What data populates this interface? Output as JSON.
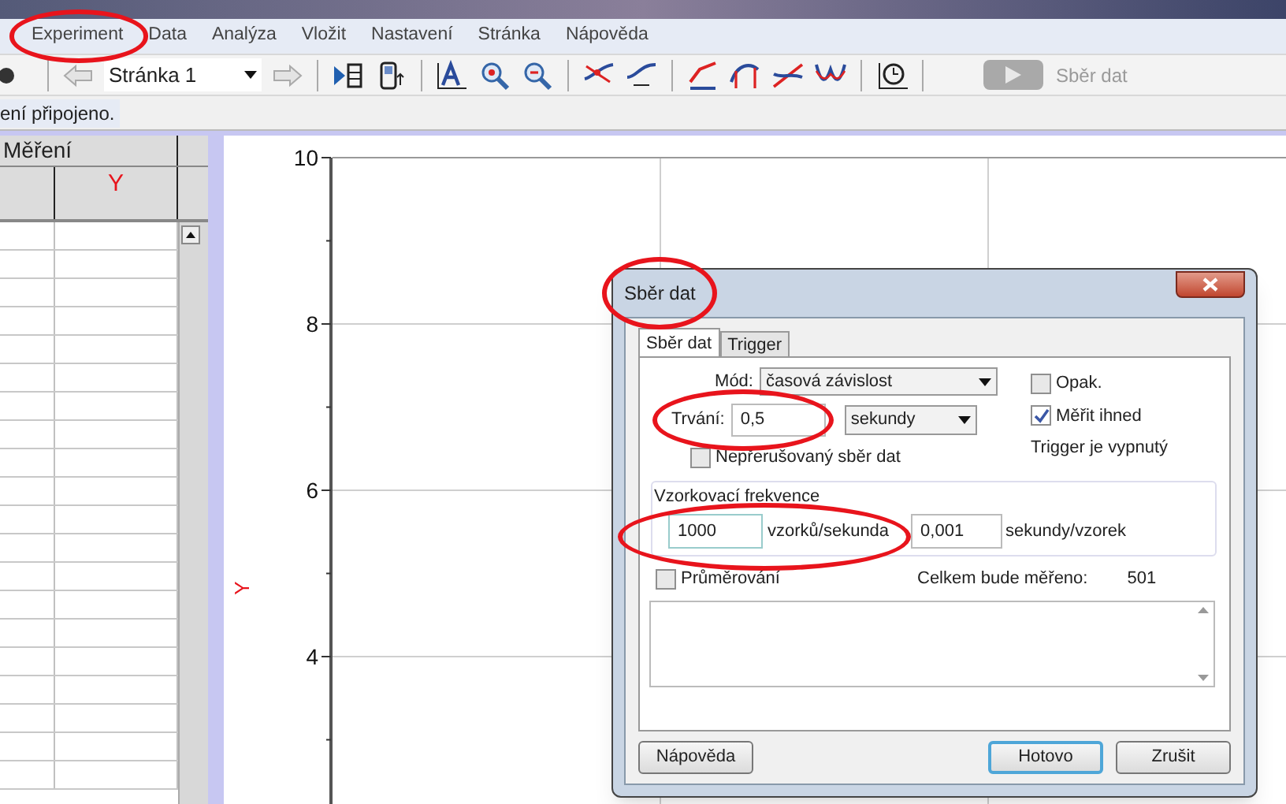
{
  "menu": [
    {
      "label": "Experiment",
      "circled": true
    },
    {
      "label": "Data",
      "circled": false
    },
    {
      "label": "Analýza",
      "circled": false
    },
    {
      "label": "Vložit",
      "circled": false
    },
    {
      "label": "Nastavení",
      "circled": false
    },
    {
      "label": "Stránka",
      "circled": false
    },
    {
      "label": "Nápověda",
      "circled": false
    }
  ],
  "toolbar": {
    "page_select": {
      "value": "Stránka 1"
    },
    "collect_button": {
      "label": "Sběr dat",
      "disabled": true
    }
  },
  "status": "ení připojeno.",
  "table": {
    "title": "Měření",
    "column_header": "Y"
  },
  "graph": {
    "y_axis_label": "Y",
    "y_ticks": [
      "10",
      "8",
      "6",
      "4"
    ]
  },
  "dialog": {
    "title": "Sběr dat",
    "circled": true,
    "tabs": [
      {
        "label": "Sběr dat",
        "selected": true
      },
      {
        "label": "Trigger",
        "selected": false
      }
    ],
    "mode": {
      "label": "Mód:",
      "value": "časová závislost"
    },
    "repeat": {
      "label": "Opak.",
      "checked": false
    },
    "measure_now": {
      "label": "Měřit ihned",
      "checked": true
    },
    "trigger_status": "Trigger je vypnutý",
    "duration": {
      "label": "Trvání:",
      "value": "0,5",
      "unit": "sekundy",
      "circled": true
    },
    "continuous": {
      "label": "Nepřerušovaný sběr dat",
      "checked": false
    },
    "sampling": {
      "title": "Vzorkovací frekvence",
      "rate": {
        "value": "1000",
        "unit": "vzorků/sekunda",
        "circled": true
      },
      "interval": {
        "value": "0,001",
        "unit": "sekundy/vzorek"
      }
    },
    "averaging": {
      "label": "Průměrování",
      "checked": false
    },
    "total": {
      "label": "Celkem bude měřeno:",
      "value": "501"
    },
    "buttons": [
      {
        "label": "Nápověda",
        "default": false
      },
      {
        "label": "Hotovo",
        "default": true
      },
      {
        "label": "Zrušit",
        "default": false
      }
    ]
  }
}
